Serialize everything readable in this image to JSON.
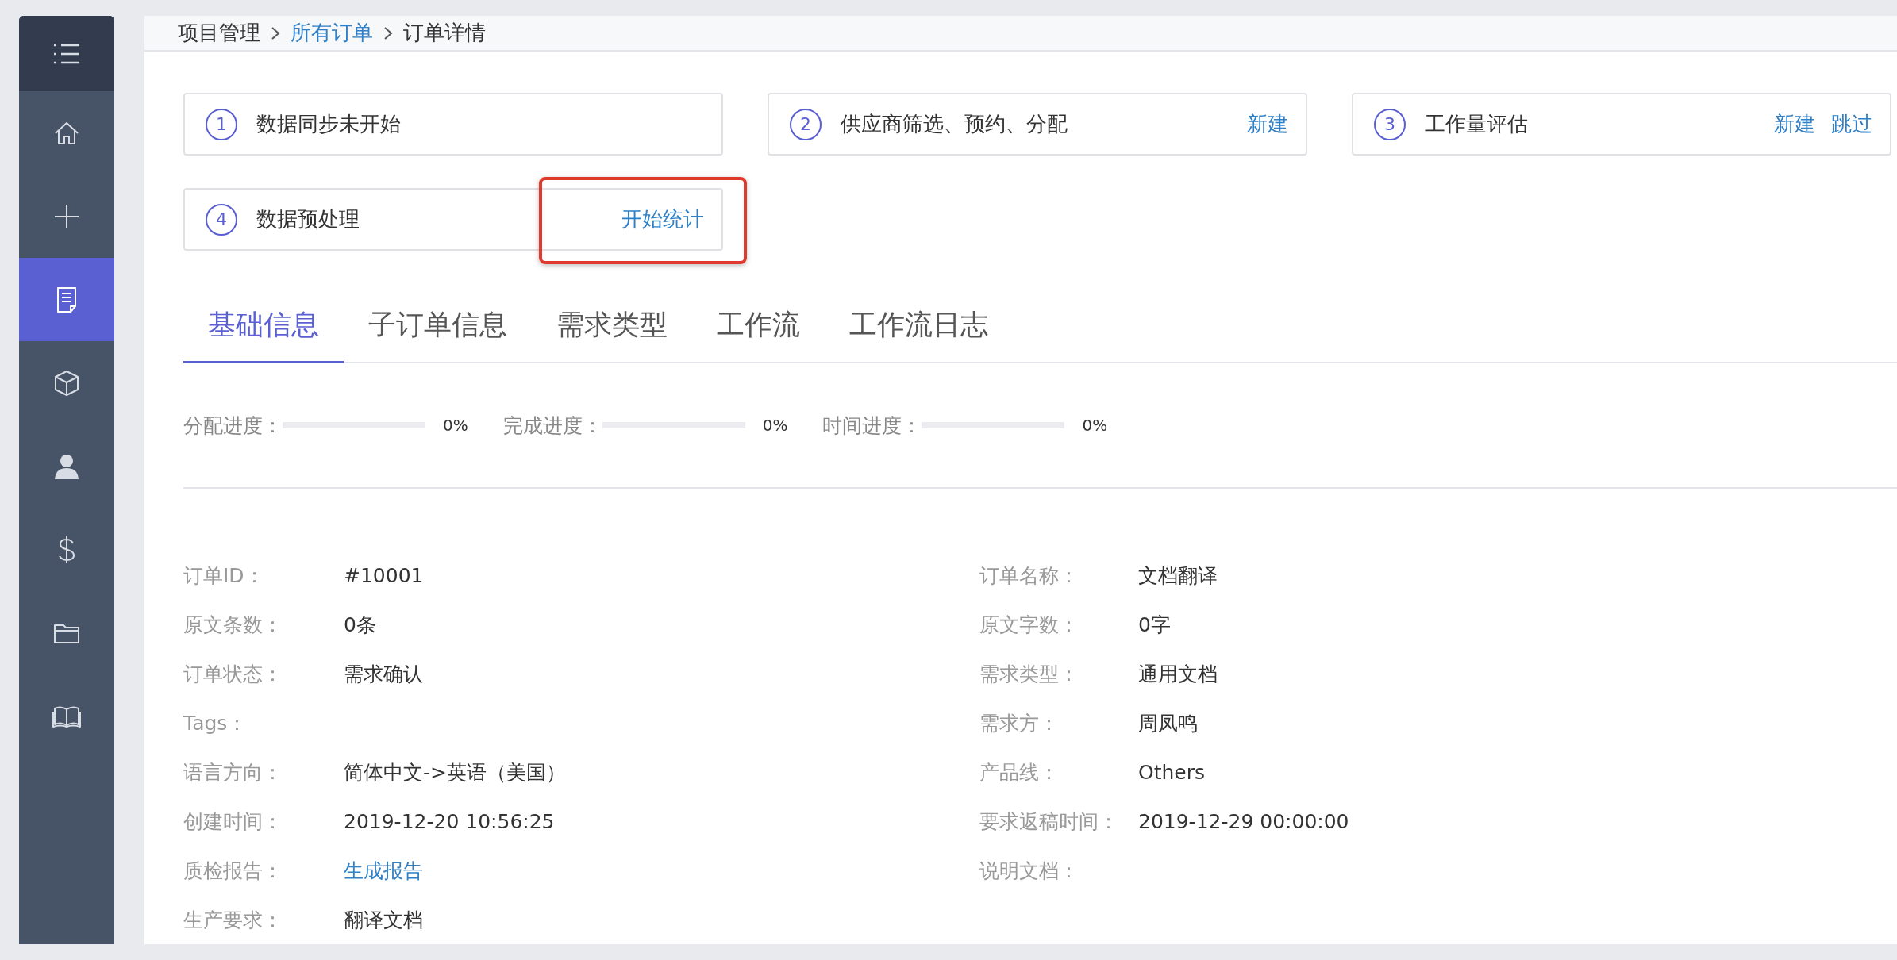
{
  "sidebar": {
    "items": [
      {
        "selected": false
      },
      {
        "selected": false
      },
      {
        "selected": true
      },
      {
        "selected": false
      },
      {
        "selected": false
      },
      {
        "selected": false
      },
      {
        "selected": false
      },
      {
        "selected": false
      }
    ]
  },
  "breadcrumb": [
    {
      "label": "项目管理",
      "kind": "text"
    },
    {
      "label": "所有订单",
      "kind": "link"
    },
    {
      "label": "订单详情",
      "kind": "text"
    }
  ],
  "steps": [
    {
      "number": "1",
      "title": "数据同步未开始"
    },
    {
      "number": "2",
      "title": "供应商筛选、预约、分配",
      "actions": [
        {
          "label": "新建",
          "highlighted": false
        }
      ]
    },
    {
      "number": "3",
      "title": "工作量评估",
      "actions": [
        {
          "label": "新建",
          "highlighted": false
        },
        {
          "label": "跳过",
          "highlighted": false
        }
      ]
    },
    {
      "number": "4",
      "title": "数据预处理",
      "actions": [
        {
          "label": "开始统计",
          "highlighted": true
        }
      ]
    }
  ],
  "tabs": [
    {
      "label": "基础信息",
      "selected": true
    },
    {
      "label": "子订单信息",
      "selected": false
    },
    {
      "label": "需求类型",
      "selected": false
    },
    {
      "label": "工作流",
      "selected": false
    },
    {
      "label": "工作流日志",
      "selected": false
    }
  ],
  "progress": [
    {
      "label": "分配进度：",
      "level": 0,
      "reading": "0%"
    },
    {
      "label": "完成进度：",
      "level": 0,
      "reading": "0%"
    },
    {
      "label": "时间进度：",
      "level": 0,
      "reading": "0%"
    }
  ],
  "details": {
    "left": [
      {
        "label": "订单ID：",
        "value": "#10001"
      },
      {
        "label": "原文条数：",
        "value": "0条"
      },
      {
        "label": "订单状态：",
        "value": "需求确认"
      },
      {
        "label": "Tags："
      },
      {
        "label": "语言方向：",
        "value": "简体中文->英语（美国）"
      },
      {
        "label": "创建时间：",
        "value": "2019-12-20 10:56:25"
      },
      {
        "label": "质检报告：",
        "value": "生成报告",
        "kind": "link"
      },
      {
        "label": "生产要求：",
        "value": "翻译文档"
      }
    ],
    "right": [
      {
        "label": "订单名称：",
        "value": "文档翻译"
      },
      {
        "label": "原文字数：",
        "value": "0字"
      },
      {
        "label": "需求类型：",
        "value": "通用文档"
      },
      {
        "label": "需求方：",
        "value": "周凤鸣"
      },
      {
        "label": "产品线：",
        "value": "Others"
      },
      {
        "label": "要求返稿时间：",
        "value": "2019-12-29 00:00:00"
      },
      {
        "label": "说明文档："
      }
    ]
  }
}
